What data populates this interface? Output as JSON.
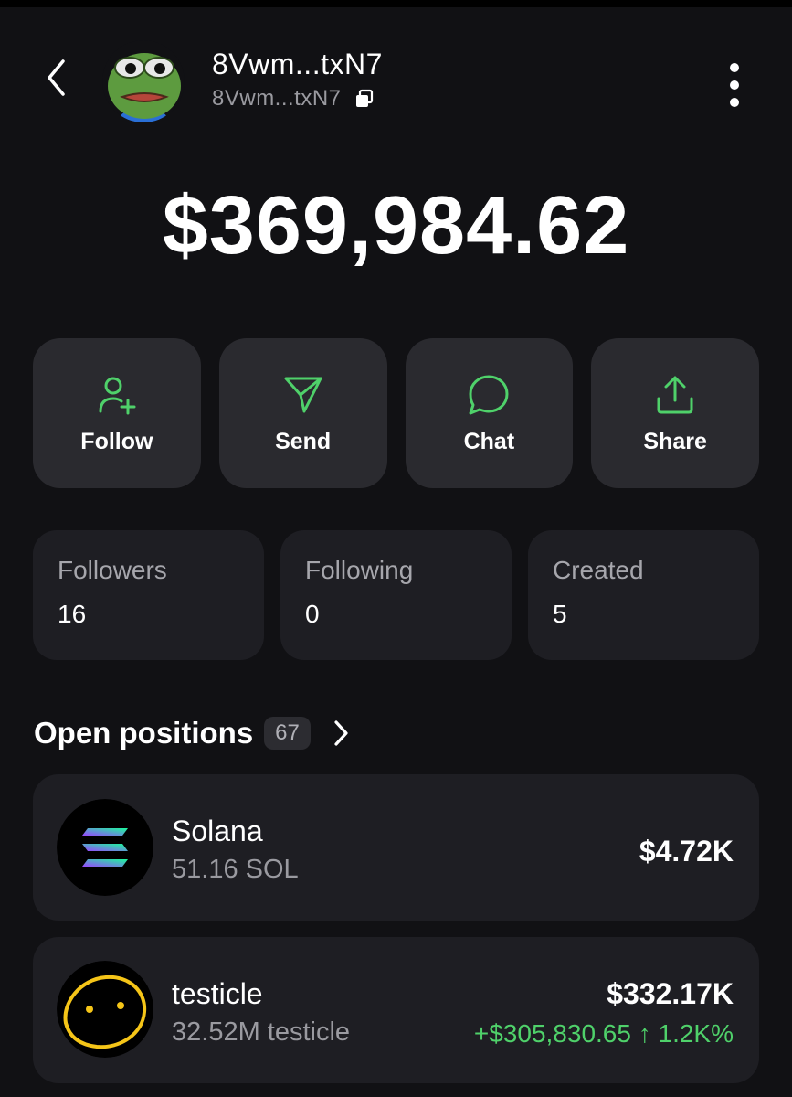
{
  "header": {
    "title": "8Vwm...txN7",
    "subtitle": "8Vwm...txN7"
  },
  "balance": "$369,984.62",
  "actions": [
    {
      "label": "Follow",
      "icon": "user-plus-icon"
    },
    {
      "label": "Send",
      "icon": "send-icon"
    },
    {
      "label": "Chat",
      "icon": "chat-bubble-icon"
    },
    {
      "label": "Share",
      "icon": "share-icon"
    }
  ],
  "stats": [
    {
      "label": "Followers",
      "value": "16"
    },
    {
      "label": "Following",
      "value": "0"
    },
    {
      "label": "Created",
      "value": "5"
    }
  ],
  "positions": {
    "title": "Open positions",
    "count": "67",
    "items": [
      {
        "name": "Solana",
        "amount": "51.16 SOL",
        "value": "$4.72K",
        "pnl": ""
      },
      {
        "name": "testicle",
        "amount": "32.52M testicle",
        "value": "$332.17K",
        "pnl": "+$305,830.65 ↑ 1.2K%"
      }
    ]
  },
  "colors": {
    "background": "#111114",
    "card": "#1e1e23",
    "button": "#2a2a2f",
    "accent_green": "#4fd16a",
    "muted_text": "#9a9aa0"
  }
}
